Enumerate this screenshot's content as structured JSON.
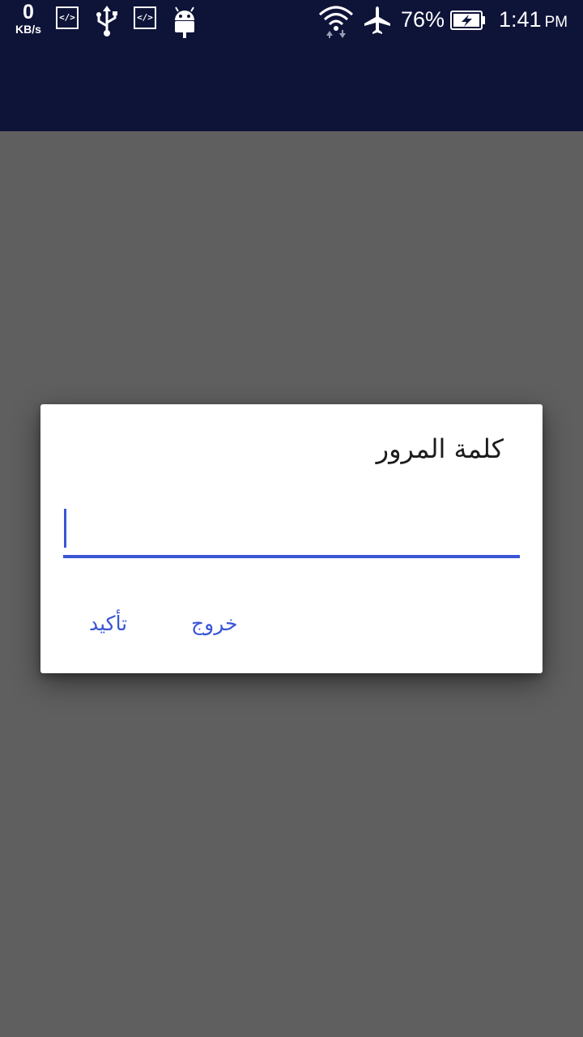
{
  "status_bar": {
    "network_speed_value": "0",
    "network_speed_unit": "KB/s",
    "left_icons": [
      "code-icon",
      "usb-icon",
      "code-icon",
      "android-icon"
    ],
    "right_icons": [
      "wifi-icon",
      "airplane-mode-icon",
      "battery-charging-icon"
    ],
    "battery_percent": "76%",
    "time": "1:41",
    "ampm": "PM"
  },
  "dialog": {
    "title": "كلمة المرور",
    "password_value": "",
    "exit_label": "خروج",
    "confirm_label": "تأكيد"
  },
  "colors": {
    "status_bar": "#0e1338",
    "app_bar": "#0e1338",
    "scrim": "#5f5f5f",
    "accent": "#3a55d5",
    "dialog_bg": "#ffffff"
  }
}
